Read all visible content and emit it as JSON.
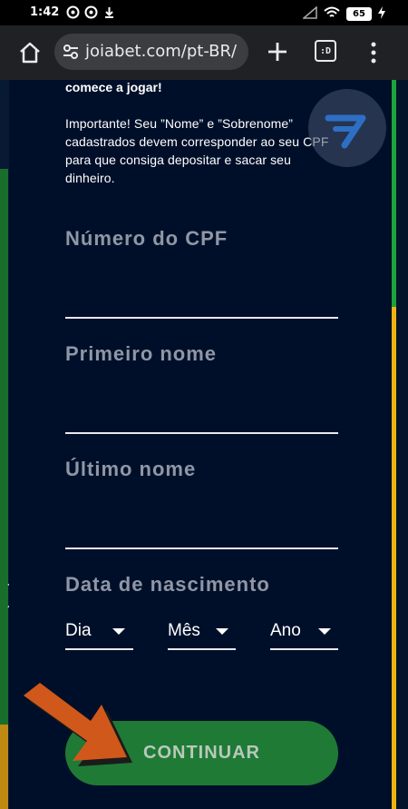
{
  "status_bar": {
    "time": "1:42",
    "battery": "65"
  },
  "browser": {
    "url": "joiabet.com/pt-BR/",
    "tabs_label": ":D"
  },
  "form": {
    "lead_text": "comece a jogar!",
    "note_text": "Importante! Seu ”Nome” e ”Sobrenome” cadastrados devem corresponder ao seu CPF para que consiga depositar e sacar seu dinheiro.",
    "cpf_label": "Número do CPF",
    "first_name_label": "Primeiro nome",
    "last_name_label": "Último nome",
    "dob_label": "Data de nascimento",
    "day_placeholder": "Dia",
    "month_placeholder": "Mês",
    "year_placeholder": "Ano",
    "continue_label": "CONTINUAR"
  },
  "colors": {
    "page_bg": "#000f29",
    "button_green": "#1f7a35",
    "arrow_orange": "#d0581b"
  }
}
